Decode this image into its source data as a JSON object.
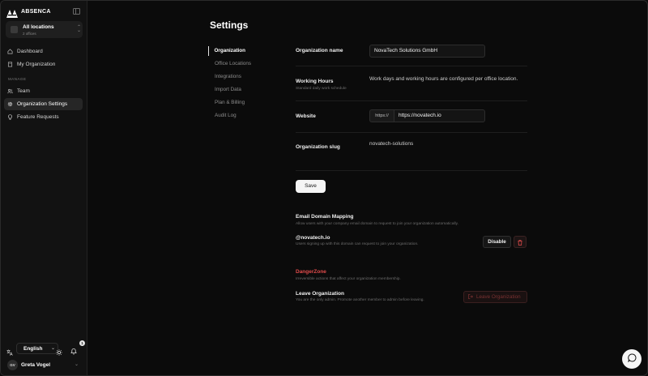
{
  "app": {
    "brand": "ABSENCA"
  },
  "location_switcher": {
    "title": "All locations",
    "subtitle": "2 offices"
  },
  "sidebar": {
    "items_top": [
      {
        "label": "Dashboard",
        "icon": "home-icon"
      },
      {
        "label": "My Organization",
        "icon": "building-icon"
      }
    ],
    "section_label": "MANAGE",
    "items_manage": [
      {
        "label": "Team",
        "icon": "users-icon"
      },
      {
        "label": "Organization Settings",
        "icon": "gear-icon",
        "active": true
      },
      {
        "label": "Feature Requests",
        "icon": "lightbulb-icon"
      }
    ],
    "language": "English",
    "notification_count": "1",
    "user": {
      "initials": "GV",
      "name": "Greta Vogel"
    }
  },
  "page": {
    "title": "Settings"
  },
  "subnav": [
    {
      "label": "Organization",
      "active": true
    },
    {
      "label": "Office Locations"
    },
    {
      "label": "Integrations"
    },
    {
      "label": "Import Data"
    },
    {
      "label": "Plan & Billing"
    },
    {
      "label": "Audit Log"
    }
  ],
  "form": {
    "org_name": {
      "label": "Organization name",
      "value": "NovaTech Solutions GmbH"
    },
    "working_hours": {
      "label": "Working Hours",
      "sublabel": "Standard daily work schedule",
      "value": "Work days and working hours are configured per office location."
    },
    "website": {
      "label": "Website",
      "prefix": "https://",
      "value": "https://novatech.io"
    },
    "slug": {
      "label": "Organization slug",
      "value": "novatech-solutions"
    },
    "save_label": "Save"
  },
  "email_domain": {
    "title": "Email Domain Mapping",
    "description": "Allow users with your company email domain to request to join your organization automatically.",
    "domain": "@novatech.io",
    "domain_note": "Users signing up with this domain can request to join your organization.",
    "disable_label": "Disable"
  },
  "danger_zone": {
    "title": "DangerZone",
    "description": "Irreversible actions that affect your organization membership.",
    "leave_title": "Leave Organization",
    "leave_note": "You are the only admin. Promote another member to admin before leaving.",
    "leave_button": "Leave Organization"
  },
  "colors": {
    "danger": "#e14b4b",
    "accent": "#f5f5f5",
    "background": "#0b0b0b"
  }
}
